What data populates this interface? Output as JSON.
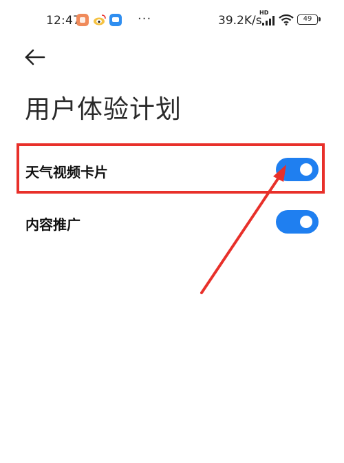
{
  "status_bar": {
    "time": "12:47",
    "more_indicator": "···",
    "net_speed": "39.2K/s",
    "hd_label": "HD",
    "battery": "49",
    "icons": [
      "xiaohongshu-app-icon",
      "weibo-app-icon",
      "chat-app-icon",
      "signal-icon",
      "wifi-icon",
      "battery-icon"
    ]
  },
  "header": {
    "back_icon": "arrow-left-icon",
    "title": "用户体验计划"
  },
  "settings": [
    {
      "label": "天气视频卡片",
      "enabled": true
    },
    {
      "label": "内容推广",
      "enabled": true
    }
  ],
  "annotation": {
    "highlight_color": "#e8302a",
    "arrow_color": "#e8302a"
  },
  "colors": {
    "toggle_on": "#1f7ff0",
    "background": "#ffffff"
  }
}
